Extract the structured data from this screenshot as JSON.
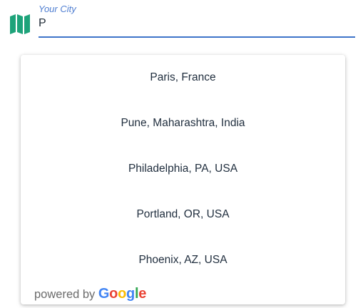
{
  "location_field": {
    "icon": "map-icon",
    "label": "Your City",
    "value": "P",
    "accent_color": "#3f74c9",
    "icon_color": "#1ea37a"
  },
  "suggestions": [
    {
      "label": "Paris, France"
    },
    {
      "label": "Pune, Maharashtra, India"
    },
    {
      "label": "Philadelphia, PA, USA"
    },
    {
      "label": "Portland, OR, USA"
    },
    {
      "label": "Phoenix, AZ, USA"
    }
  ],
  "attribution": {
    "prefix": "powered by",
    "brand": "Google",
    "brand_letters": [
      "G",
      "o",
      "o",
      "g",
      "l",
      "e"
    ],
    "brand_colors": [
      "#4285F4",
      "#EA4335",
      "#FBBC05",
      "#4285F4",
      "#34A853",
      "#EA4335"
    ]
  }
}
